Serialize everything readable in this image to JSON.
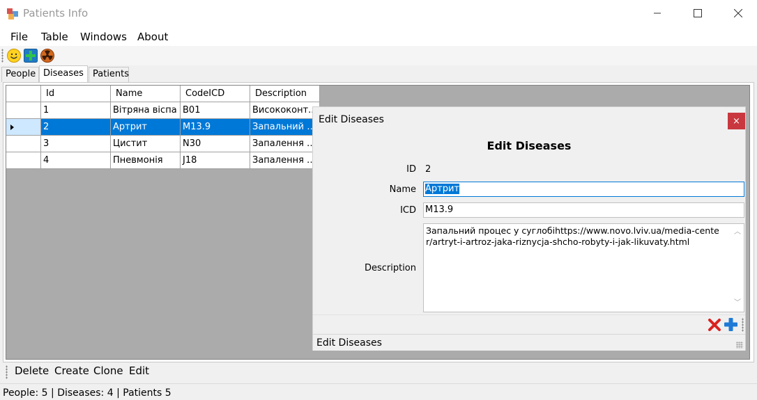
{
  "window": {
    "title": "Patients Info"
  },
  "menu": {
    "items": [
      "File",
      "Table",
      "Windows",
      "About"
    ]
  },
  "toolbar": {
    "icons": [
      "smiley-icon",
      "add-icon",
      "radiation-icon"
    ]
  },
  "tabs": [
    {
      "label": "People",
      "active": false
    },
    {
      "label": "Diseases",
      "active": true
    },
    {
      "label": "Patients",
      "active": false
    }
  ],
  "grid": {
    "columns": [
      "Id",
      "Name",
      "CodeICD",
      "Description"
    ],
    "rows": [
      {
        "id": "1",
        "name": "Вітряна віспа",
        "icd": "B01",
        "description": "Висококонт...",
        "selected": false
      },
      {
        "id": "2",
        "name": "Артрит",
        "icd": "M13.9",
        "description": "Запальний п...",
        "selected": true
      },
      {
        "id": "3",
        "name": "Цистит",
        "icd": "N30",
        "description": "Запалення с...",
        "selected": false
      },
      {
        "id": "4",
        "name": "Пневмонія",
        "icd": "J18",
        "description": "Запалення л...",
        "selected": false
      }
    ]
  },
  "actions": {
    "delete": "Delete",
    "create": "Create",
    "clone": "Clone",
    "edit": "Edit"
  },
  "status": {
    "text": "People: 5 | Diseases: 4 | Patients 5"
  },
  "dialog": {
    "title": "Edit Diseases",
    "heading": "Edit Diseases",
    "close_label": "×",
    "id_label": "ID",
    "id_value": "2",
    "name_label": "Name",
    "name_value": "Артрит",
    "icd_label": "ICD",
    "icd_value": "M13.9",
    "description_label": "Description",
    "description_value": "Запальний процес у суглобіhttps://www.novo.lviv.ua/media-center/artryt-i-artroz-jaka-riznycja-shcho-robyty-i-jak-likuvaty.html",
    "status_text": "Edit Diseases",
    "toolbar_icons": [
      "cancel-icon",
      "add-icon"
    ]
  },
  "colors": {
    "selection": "#0078d7",
    "close_button": "#c9383f",
    "grid_background": "#ababab"
  }
}
